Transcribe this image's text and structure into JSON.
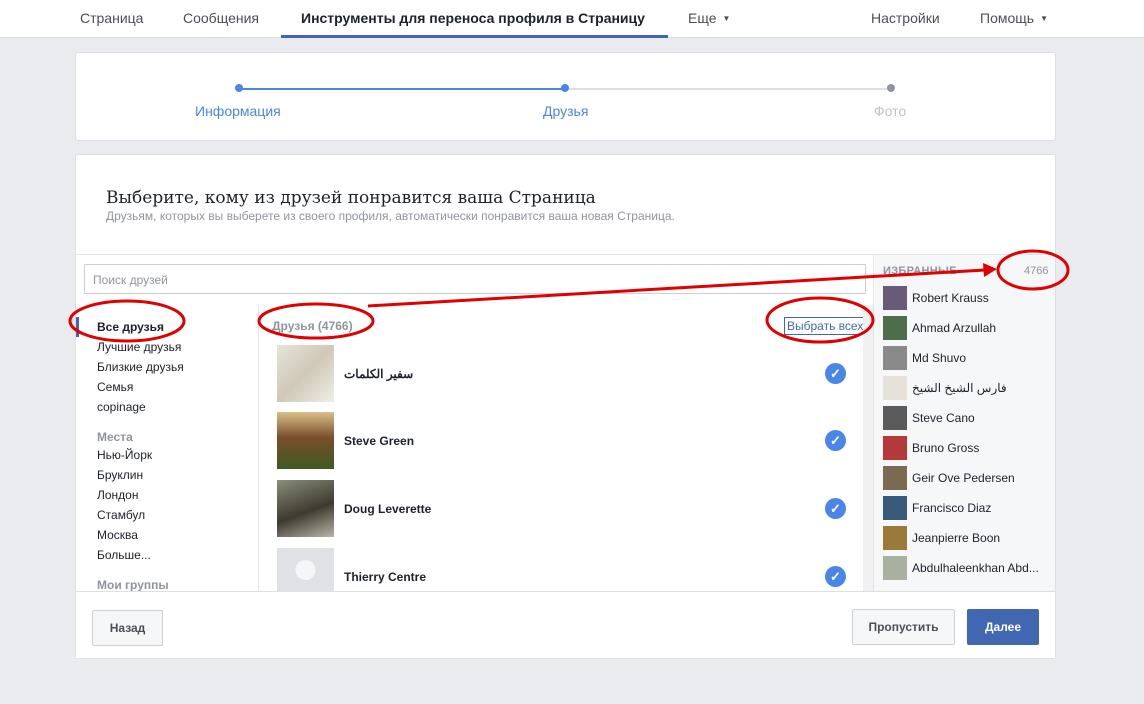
{
  "nav": {
    "tabs": [
      "Страница",
      "Сообщения",
      "Инструменты для переноса профиля в Страницу",
      "Еще"
    ],
    "right_tabs": [
      "Настройки",
      "Помощь"
    ]
  },
  "progress": {
    "steps": [
      "Информация",
      "Друзья",
      "Фото"
    ],
    "current_step": 2
  },
  "main": {
    "title": "Выберите, кому из друзей понравится ваша Страница",
    "subtitle": "Друзьям, которых вы выберете из своего профиля, автоматически понравится ваша новая Страница."
  },
  "search": {
    "placeholder": "Поиск друзей"
  },
  "leftnav": {
    "lists": [
      "Все друзья",
      "Лучшие друзья",
      "Близкие друзья",
      "Семья",
      "copinage"
    ],
    "places_header": "Места",
    "places": [
      "Нью-Йорк",
      "Бруклин",
      "Лондон",
      "Стамбул",
      "Москва",
      "Больше..."
    ],
    "groups_header": "Мои группы"
  },
  "friends": {
    "title": "Друзья (4766)",
    "select_all": "Выбрать всех",
    "rows": [
      {
        "name": "سفير الكلمات",
        "selected": true
      },
      {
        "name": "Steve Green",
        "selected": true
      },
      {
        "name": "Doug Leverette",
        "selected": true
      },
      {
        "name": "Thierry Centre",
        "selected": true
      }
    ]
  },
  "favorites": {
    "header": "ИЗБРАННЫЕ",
    "count": "4766",
    "items": [
      "Robert Krauss",
      "Ahmad Arzullah",
      "Md Shuvo",
      "فارس الشيخ الشيخ",
      "Steve Cano",
      "Bruno Gross",
      "Geir Ove Pedersen",
      "Francisco Diaz",
      "Jeanpierre Boon",
      "Abdulhaleenkhan Abd..."
    ]
  },
  "footer": {
    "back": "Назад",
    "skip": "Пропустить",
    "next": "Далее"
  },
  "colors": {
    "brand": "#4267b2",
    "check": "#4a86e8",
    "annotation": "#e00000"
  },
  "icons": {
    "check": "check-icon",
    "caret": "caret-down-icon"
  }
}
